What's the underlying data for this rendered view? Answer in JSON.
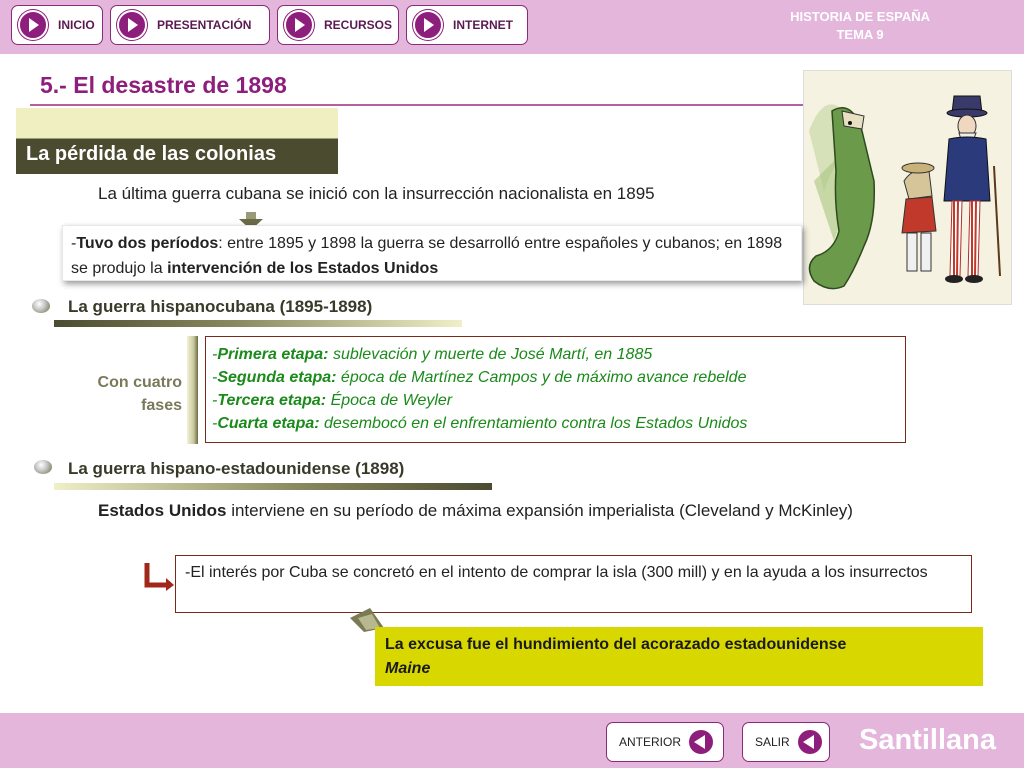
{
  "nav": {
    "inicio": "INICIO",
    "presentacion": "PRESENTACIÓN",
    "recursos": "RECURSOS",
    "internet": "INTERNET"
  },
  "header": {
    "course_line1": "HISTORIA DE ESPAÑA",
    "course_line2": "TEMA 9"
  },
  "title": "5.- El desastre de 1898",
  "section": {
    "heading": "La pérdida de las colonias",
    "intro": "La última guerra cubana se inició con la insurrección nacionalista en 1895",
    "periods": {
      "dash": "-",
      "b1": "Tuvo dos períodos",
      "t1": ": entre 1895 y 1898 la guerra se desarrolló entre españoles y cubanos; en 1898 se produjo la ",
      "b2": "intervención de los Estados Unidos"
    }
  },
  "hispanocubana": {
    "heading": "La guerra hispanocubana (1895-1898)",
    "fases_label": "Con cuatro fases",
    "stages": [
      {
        "label": "Primera etapa:",
        "text": " sublevación y muerte de José Martí, en 1885"
      },
      {
        "label": "Segunda etapa:",
        "text": "  época de Martínez Campos y de máximo avance rebelde"
      },
      {
        "label": "Tercera etapa:",
        "text": " Época de Weyler"
      },
      {
        "label": "Cuarta etapa:",
        "text": " desembocó en el enfrentamiento contra los Estados Unidos"
      }
    ]
  },
  "estadounidense": {
    "heading": "La guerra hispano-estadounidense (1898)",
    "intro_bold": "Estados Unidos",
    "intro_rest": " interviene en su período de máxima expansión imperialista (Cleveland y McKinley)",
    "interest": "-El interés por Cuba se concretó en el intento de comprar la isla (300 mill) y en la ayuda a los insurrectos",
    "excuse": "La excusa fue el hundimiento del acorazado estadounidense",
    "excuse_ship": "Maine"
  },
  "footer": {
    "anterior": "ANTERIOR",
    "salir": "SALIR",
    "brand": "Santillana"
  },
  "colors": {
    "accent": "#8e1e7c",
    "bar": "#e4b6dc",
    "green_text": "#1a8a1a",
    "highlight": "#d8d800",
    "dark_olive": "#4b4b30"
  }
}
